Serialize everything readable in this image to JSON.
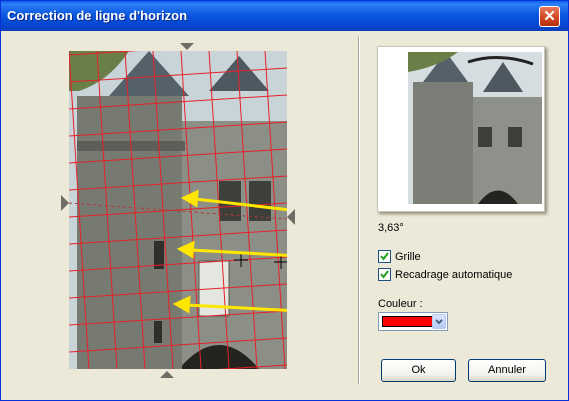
{
  "window": {
    "title": "Correction de ligne d'horizon",
    "close_glyph": "✕"
  },
  "preview": {
    "angle": "3,63°",
    "grid_color": "#e8202a",
    "arrow_color": "#ffe600"
  },
  "options": {
    "grid": {
      "label": "Grille",
      "checked": true
    },
    "auto_crop": {
      "label": "Recadrage automatique",
      "checked": true
    }
  },
  "color": {
    "label": "Couleur :",
    "value": "#ff0000"
  },
  "buttons": {
    "ok": "Ok",
    "cancel": "Annuler"
  }
}
